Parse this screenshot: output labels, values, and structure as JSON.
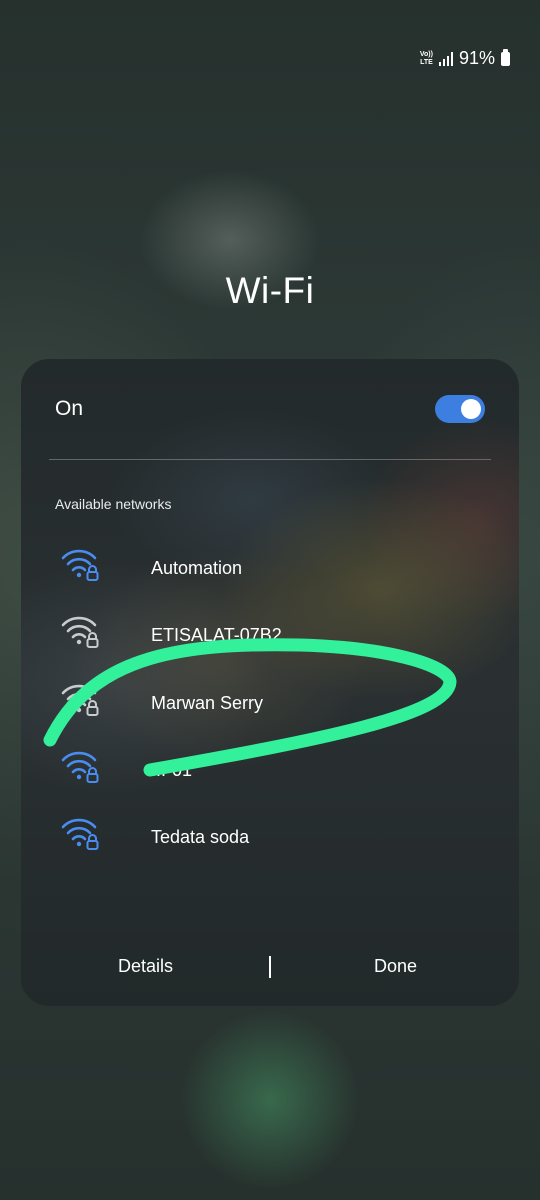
{
  "status_bar": {
    "volte_line1": "Vo))",
    "volte_line2": "LTE",
    "signal_icon": "signal-bars-icon",
    "battery_percent": "91%",
    "battery_icon": "battery-icon"
  },
  "title": "Wi-Fi",
  "wifi_toggle": {
    "label": "On",
    "state": true,
    "accent": "#3c7fe0"
  },
  "section_label": "Available networks",
  "networks": [
    {
      "name": "Automation",
      "icon": "wifi-lock-icon",
      "color": "#4a8df0"
    },
    {
      "name": "ETISALAT-07B2",
      "icon": "wifi-lock-icon",
      "color": "#c9cccc"
    },
    {
      "name": "Marwan Serry",
      "icon": "wifi-lock-icon",
      "color": "#c9cccc"
    },
    {
      "name": "...-01",
      "icon": "wifi-lock-icon",
      "color": "#4a8df0"
    },
    {
      "name": "Tedata soda",
      "icon": "wifi-lock-icon",
      "color": "#4a8df0"
    }
  ],
  "buttons": {
    "details": "Details",
    "done": "Done"
  },
  "annotation": {
    "color": "#33f09a"
  }
}
